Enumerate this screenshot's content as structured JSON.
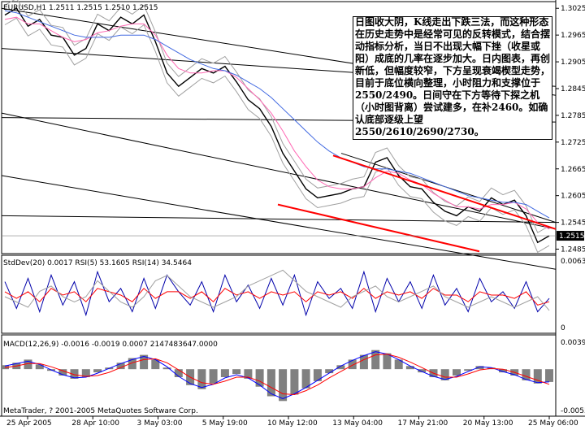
{
  "chart_data": [
    {
      "type": "line",
      "title": "EURUSD,H1",
      "ohlc_readout": "1.2511 1.2515 1.2510 1.2515",
      "current_price_label": "1.2515",
      "yticks": [
        "1.3025",
        "1.2965",
        "1.2905",
        "1.2845",
        "1.2785",
        "1.2725",
        "1.2665",
        "1.2605",
        "1.2545",
        "1.2485"
      ],
      "ylim": [
        1.2475,
        1.304
      ],
      "xticks": [
        "25 Apr 2005",
        "28 Apr 10:00",
        "3 May 03:00",
        "5 May 19:00",
        "10 May 12:00",
        "13 May 04:00",
        "17 May 21:00",
        "20 May 13:00",
        "25 May 06:00"
      ],
      "x_start": "2005-04-25",
      "x_end": "2005-05-26",
      "series": [
        {
          "name": "",
          "color": "#000000",
          "values": [
            1.301,
            1.3025,
            1.2985,
            1.3,
            1.2965,
            1.296,
            1.292,
            1.2935,
            1.299,
            1.2975,
            1.3005,
            1.299,
            1.301,
            1.295,
            1.288,
            1.285,
            1.287,
            1.289,
            1.288,
            1.2895,
            1.286,
            1.282,
            1.28,
            1.276,
            1.27,
            1.266,
            1.262,
            1.26,
            1.2605,
            1.261,
            1.262,
            1.2625,
            1.268,
            1.269,
            1.265,
            1.2625,
            1.262,
            1.259,
            1.257,
            1.256,
            1.258,
            1.257,
            1.26,
            1.2585,
            1.2595,
            1.256,
            1.25,
            1.2515
          ]
        },
        {
          "name": "",
          "color": "#ff69b4",
          "values": [
            1.3,
            1.3005,
            1.299,
            1.299,
            1.2975,
            1.296,
            1.295,
            1.2955,
            1.297,
            1.2975,
            1.2985,
            1.299,
            1.299,
            1.2965,
            1.292,
            1.289,
            1.288,
            1.288,
            1.2885,
            1.2885,
            1.287,
            1.2845,
            1.282,
            1.279,
            1.275,
            1.2705,
            1.267,
            1.264,
            1.2625,
            1.262,
            1.262,
            1.2625,
            1.2645,
            1.266,
            1.2655,
            1.264,
            1.263,
            1.261,
            1.2595,
            1.258,
            1.258,
            1.2575,
            1.2585,
            1.2585,
            1.259,
            1.2575,
            1.2545,
            1.253
          ]
        },
        {
          "name": "",
          "color": "#4169e1",
          "values": [
            1.302,
            1.3015,
            1.3005,
            1.2995,
            1.2985,
            1.2975,
            1.2965,
            1.296,
            1.296,
            1.296,
            1.2965,
            1.2965,
            1.2965,
            1.2955,
            1.294,
            1.2925,
            1.291,
            1.29,
            1.289,
            1.2885,
            1.2875,
            1.286,
            1.2845,
            1.2825,
            1.28,
            1.2775,
            1.275,
            1.2725,
            1.2705,
            1.269,
            1.268,
            1.267,
            1.2665,
            1.2665,
            1.266,
            1.2655,
            1.2645,
            1.2635,
            1.2625,
            1.2615,
            1.2605,
            1.26,
            1.2595,
            1.259,
            1.259,
            1.2585,
            1.257,
            1.2555
          ]
        }
      ]
    },
    {
      "type": "line",
      "title": "StdDev(20) 0.0017  RSI(5) 53.1605  RSI(14) 34.5464",
      "yticks": [
        "0.0063",
        "0"
      ],
      "ylim": [
        0,
        0.0063
      ],
      "series": [
        {
          "name": "",
          "color": "#0000aa",
          "values": [
            70,
            30,
            75,
            25,
            80,
            35,
            70,
            20,
            85,
            40,
            60,
            25,
            75,
            30,
            80,
            55,
            35,
            70,
            25,
            80,
            40,
            65,
            30,
            75,
            35,
            80,
            20,
            70,
            45,
            60,
            30,
            85,
            25,
            75,
            40,
            70,
            30,
            80,
            35,
            60,
            25,
            75,
            40,
            55,
            30,
            70,
            25,
            45
          ]
        },
        {
          "name": "",
          "color": "#ff0000",
          "values": [
            55,
            45,
            55,
            40,
            60,
            50,
            55,
            40,
            60,
            55,
            50,
            40,
            60,
            45,
            55,
            55,
            45,
            55,
            40,
            60,
            50,
            55,
            45,
            55,
            50,
            55,
            40,
            55,
            50,
            55,
            45,
            60,
            45,
            55,
            50,
            55,
            45,
            60,
            50,
            50,
            40,
            55,
            50,
            50,
            45,
            55,
            35,
            40
          ]
        },
        {
          "name": "",
          "color": "#a0a0a0",
          "values": [
            0.003,
            0.0025,
            0.002,
            0.0035,
            0.004,
            0.003,
            0.0025,
            0.003,
            0.0045,
            0.0035,
            0.0025,
            0.002,
            0.003,
            0.0045,
            0.005,
            0.004,
            0.003,
            0.0025,
            0.002,
            0.0025,
            0.003,
            0.004,
            0.0045,
            0.005,
            0.0055,
            0.0045,
            0.0035,
            0.003,
            0.0025,
            0.002,
            0.003,
            0.0035,
            0.004,
            0.003,
            0.0025,
            0.003,
            0.0035,
            0.004,
            0.003,
            0.0025,
            0.002,
            0.0025,
            0.003,
            0.0025,
            0.002,
            0.0025,
            0.003,
            0.0017
          ]
        }
      ]
    },
    {
      "type": "bar",
      "title": "MACD(12,26,9) -0.0016 -0.0019 0.0007 2147483647.0000",
      "yticks": [
        "0.0039",
        "-0.0055"
      ],
      "ylim": [
        -0.0055,
        0.0039
      ],
      "histogram": [
        0.0005,
        0.0008,
        0.0012,
        0.0006,
        -0.0002,
        -0.0008,
        -0.0012,
        -0.001,
        -0.0004,
        0.0002,
        0.0008,
        0.0014,
        0.0018,
        0.0012,
        0.0002,
        -0.001,
        -0.002,
        -0.0025,
        -0.0018,
        -0.001,
        -0.0006,
        -0.0012,
        -0.0022,
        -0.0034,
        -0.004,
        -0.0032,
        -0.0024,
        -0.0015,
        -0.0005,
        0.0005,
        0.0012,
        0.0018,
        0.0024,
        0.002,
        0.0012,
        0.0004,
        -0.0004,
        -0.001,
        -0.0014,
        -0.0008,
        -0.0002,
        0.0004,
        0.0002,
        -0.0004,
        -0.0008,
        -0.0014,
        -0.0018,
        -0.0016
      ],
      "series": [
        {
          "name": "",
          "color": "#0000ff",
          "values": [
            0.0004,
            0.0007,
            0.001,
            0.0006,
            -0.0001,
            -0.0007,
            -0.0011,
            -0.001,
            -0.0005,
            0.0001,
            0.0007,
            0.0012,
            0.0016,
            0.0012,
            0.0003,
            -0.0009,
            -0.0018,
            -0.0023,
            -0.0019,
            -0.0011,
            -0.0007,
            -0.0011,
            -0.002,
            -0.0031,
            -0.0037,
            -0.0031,
            -0.0023,
            -0.0014,
            -0.0005,
            0.0004,
            0.0011,
            0.0017,
            0.0022,
            0.0019,
            0.0012,
            0.0004,
            -0.0003,
            -0.0009,
            -0.0013,
            -0.0009,
            -0.0003,
            0.0003,
            0.0002,
            -0.0003,
            -0.0007,
            -0.0013,
            -0.0017,
            -0.0016
          ]
        },
        {
          "name": "",
          "color": "#ff0000",
          "values": [
            0.0002,
            0.0004,
            0.0007,
            0.0007,
            0.0003,
            -0.0002,
            -0.0007,
            -0.0009,
            -0.0008,
            -0.0004,
            0.0002,
            0.0008,
            0.0012,
            0.0013,
            0.0008,
            -0.0001,
            -0.001,
            -0.0017,
            -0.0019,
            -0.0015,
            -0.001,
            -0.001,
            -0.0015,
            -0.0023,
            -0.0031,
            -0.0032,
            -0.0027,
            -0.002,
            -0.0011,
            -0.0003,
            0.0005,
            0.0012,
            0.0018,
            0.0019,
            0.0015,
            0.0009,
            0.0002,
            -0.0005,
            -0.001,
            -0.001,
            -0.0006,
            -0.0001,
            0.0001,
            0.0,
            -0.0004,
            -0.0009,
            -0.0014,
            -0.0019
          ]
        }
      ]
    }
  ],
  "annotation_text": "日图收大阴，K线走出下跌三法，而这种形态在历史走势中是经常可见的反转模式，结合摆动指标分析，当日不出现大幅下挫（收星或阳）成底的几率在逐步加大。日内图表，再创新低，但幅度较窄，下方呈现衰竭楔型走势，目前于底位横向整理，小时阻力和支撑位于2550/2490。日间守在下方等待下探之机（小时图背离）尝试建多，在补2460。如确认底部逐级上望2550/2610/2690/2730。",
  "footer": "MetaTrader, ? 2001-2005 MetaQuotes Software Corp."
}
